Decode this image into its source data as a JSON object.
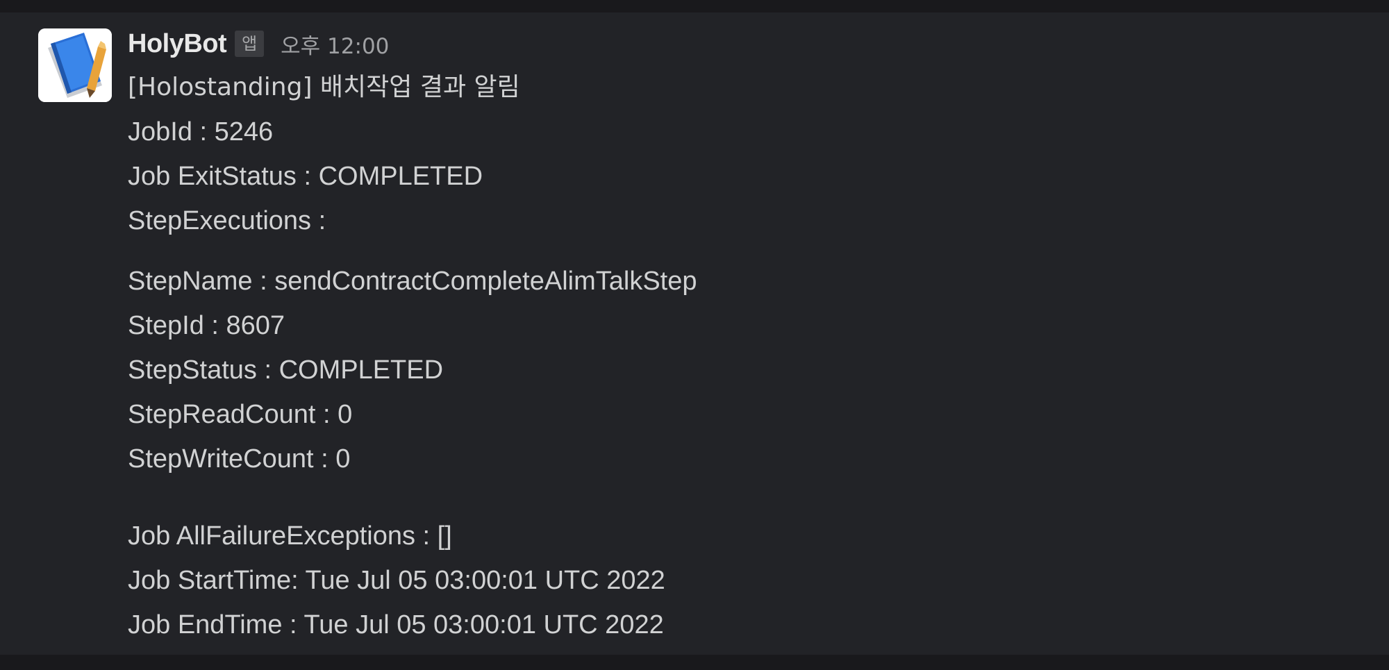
{
  "message": {
    "sender": "HolyBot",
    "app_badge": "앱",
    "timestamp": "오후 12:00",
    "title": "[Holostanding] 배치작업 결과 알림",
    "job_id": "JobId : 5246",
    "job_exit_status": "Job ExitStatus : COMPLETED",
    "step_executions_label": "StepExecutions :",
    "step_name": "StepName : sendContractCompleteAlimTalkStep",
    "step_id": "StepId : 8607",
    "step_status": "StepStatus : COMPLETED",
    "step_read_count": "StepReadCount : 0",
    "step_write_count": "StepWriteCount : 0",
    "job_failure_exceptions": "Job AllFailureExceptions : []",
    "job_start_time": "Job StartTime: Tue Jul 05 03:00:01 UTC 2022",
    "job_end_time": "Job EndTime : Tue Jul 05 03:00:01 UTC 2022"
  },
  "colors": {
    "background": "#222327",
    "text": "#d1d2d3",
    "sender": "#e8e8e8",
    "avatar_book": "#2a6fd6"
  },
  "icons": {
    "avatar": "book-icon"
  }
}
